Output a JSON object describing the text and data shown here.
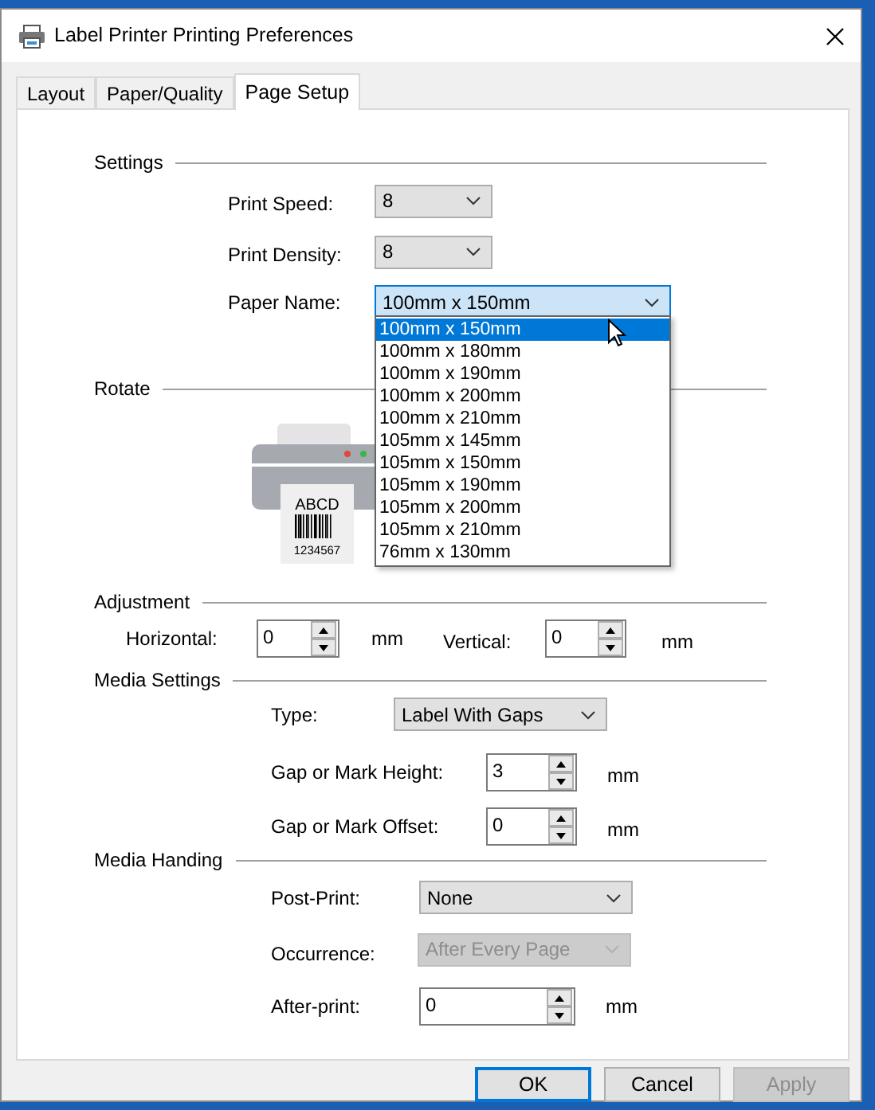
{
  "window": {
    "title": "Label Printer Printing Preferences"
  },
  "tabs": [
    {
      "label": "Layout",
      "selected": false
    },
    {
      "label": "Paper/Quality",
      "selected": false
    },
    {
      "label": "Page Setup",
      "selected": true
    }
  ],
  "settings": {
    "heading": "Settings",
    "print_speed": {
      "label": "Print Speed:",
      "value": "8"
    },
    "print_density": {
      "label": "Print Density:",
      "value": "8"
    },
    "paper_name": {
      "label": "Paper Name:",
      "value": "100mm x 150mm",
      "expanded": true,
      "options": [
        {
          "label": "100mm x 150mm",
          "selected": true
        },
        {
          "label": "100mm x 180mm",
          "selected": false
        },
        {
          "label": "100mm x 190mm",
          "selected": false
        },
        {
          "label": "100mm x 200mm",
          "selected": false
        },
        {
          "label": "100mm x 210mm",
          "selected": false
        },
        {
          "label": "105mm x 145mm",
          "selected": false
        },
        {
          "label": "105mm x 150mm",
          "selected": false
        },
        {
          "label": "105mm x 190mm",
          "selected": false
        },
        {
          "label": "105mm x 200mm",
          "selected": false
        },
        {
          "label": "105mm x 210mm",
          "selected": false
        },
        {
          "label": "76mm x 130mm",
          "selected": false
        }
      ]
    }
  },
  "rotate": {
    "heading": "Rotate",
    "label_preview": {
      "text": "ABCD",
      "number": "1234567"
    }
  },
  "adjustment": {
    "heading": "Adjustment",
    "horizontal": {
      "label": "Horizontal:",
      "value": "0",
      "unit": "mm"
    },
    "vertical": {
      "label": "Vertical:",
      "value": "0",
      "unit": "mm"
    }
  },
  "media_settings": {
    "heading": "Media Settings",
    "type": {
      "label": "Type:",
      "value": "Label With Gaps"
    },
    "gap_height": {
      "label": "Gap or Mark Height:",
      "value": "3",
      "unit": "mm"
    },
    "gap_offset": {
      "label": "Gap or Mark Offset:",
      "value": "0",
      "unit": "mm"
    }
  },
  "media_handling": {
    "heading": "Media Handing",
    "post_print": {
      "label": "Post-Print:",
      "value": "None",
      "disabled": false
    },
    "occurrence": {
      "label": "Occurrence:",
      "value": "After Every Page",
      "disabled": true
    },
    "after_print": {
      "label": "After-print:",
      "value": "0",
      "unit": "mm"
    }
  },
  "buttons": [
    {
      "label": "OK",
      "default": true,
      "disabled": false
    },
    {
      "label": "Cancel",
      "default": false,
      "disabled": false
    },
    {
      "label": "Apply",
      "default": false,
      "disabled": true
    }
  ]
}
